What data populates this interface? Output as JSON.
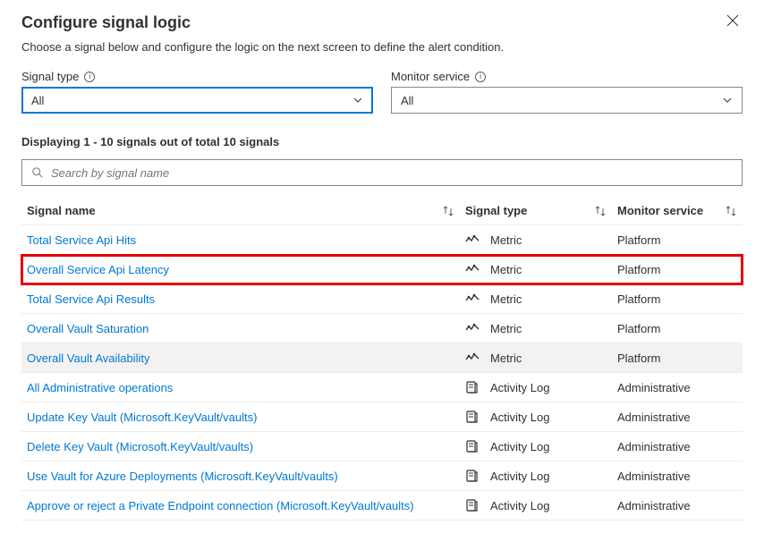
{
  "header": {
    "title": "Configure signal logic",
    "subtitle": "Choose a signal below and configure the logic on the next screen to define the alert condition."
  },
  "filters": {
    "signal_type": {
      "label": "Signal type",
      "value": "All"
    },
    "monitor_service": {
      "label": "Monitor service",
      "value": "All"
    }
  },
  "count_text": "Displaying 1 - 10 signals out of total 10 signals",
  "search": {
    "placeholder": "Search by signal name"
  },
  "table": {
    "headers": {
      "name": "Signal name",
      "type": "Signal type",
      "service": "Monitor service"
    },
    "rows": [
      {
        "name": "Total Service Api Hits",
        "type": "Metric",
        "type_icon": "metric",
        "service": "Platform",
        "flags": ""
      },
      {
        "name": "Overall Service Api Latency",
        "type": "Metric",
        "type_icon": "metric",
        "service": "Platform",
        "flags": "boxed"
      },
      {
        "name": "Total Service Api Results",
        "type": "Metric",
        "type_icon": "metric",
        "service": "Platform",
        "flags": ""
      },
      {
        "name": "Overall Vault Saturation",
        "type": "Metric",
        "type_icon": "metric",
        "service": "Platform",
        "flags": ""
      },
      {
        "name": "Overall Vault Availability",
        "type": "Metric",
        "type_icon": "metric",
        "service": "Platform",
        "flags": "highlighted"
      },
      {
        "name": "All Administrative operations",
        "type": "Activity Log",
        "type_icon": "activity",
        "service": "Administrative",
        "flags": ""
      },
      {
        "name": "Update Key Vault (Microsoft.KeyVault/vaults)",
        "type": "Activity Log",
        "type_icon": "activity",
        "service": "Administrative",
        "flags": ""
      },
      {
        "name": "Delete Key Vault (Microsoft.KeyVault/vaults)",
        "type": "Activity Log",
        "type_icon": "activity",
        "service": "Administrative",
        "flags": ""
      },
      {
        "name": "Use Vault for Azure Deployments (Microsoft.KeyVault/vaults)",
        "type": "Activity Log",
        "type_icon": "activity",
        "service": "Administrative",
        "flags": ""
      },
      {
        "name": "Approve or reject a Private Endpoint connection (Microsoft.KeyVault/vaults)",
        "type": "Activity Log",
        "type_icon": "activity",
        "service": "Administrative",
        "flags": ""
      }
    ]
  }
}
